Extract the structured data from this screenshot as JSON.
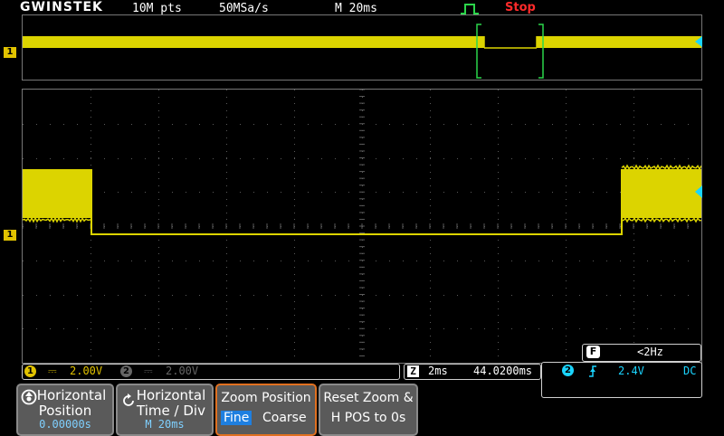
{
  "header": {
    "brand": "GWINSTEK",
    "record_length": "10M pts",
    "sample_rate": "50MSa/s",
    "timebase": "M 20ms",
    "acquire_status": "Stop",
    "status_color": "#ff2a2a",
    "trigger_type_icon": "edge-trigger-icon"
  },
  "colors": {
    "ch1": "#dcd400",
    "grid_dot": "#5a5a5a",
    "zoom_bracket": "#2bd64a",
    "trigger_marker": "#2bd64a",
    "position_marker": "#ff5a2a",
    "level_marker": "#1ad4ff"
  },
  "overview": {
    "channel_label": "1"
  },
  "main": {
    "channel_label": "1"
  },
  "freq_counter": {
    "label": "F",
    "value": "<2Hz"
  },
  "channel_bar": {
    "ch1_num": "1",
    "ch1_coupling": "⎓",
    "ch1_scale": "2.00V",
    "ch2_num": "2",
    "ch2_coupling": "⎓",
    "ch2_scale": "2.00V"
  },
  "zoom_bar": {
    "icon": "Z",
    "time_div": "2ms",
    "position": "44.0200ms"
  },
  "trigger_box": {
    "source": "2",
    "slope": "rising-edge-icon",
    "level": "2.4V",
    "coupling": "DC"
  },
  "softkeys": {
    "h_position": {
      "label1": "Horizontal",
      "label2": "Position",
      "value": "0.00000s"
    },
    "h_timediv": {
      "label1": "Horizontal",
      "label2": "Time / Div",
      "value": "M 20ms"
    },
    "zoom_position": {
      "label1": "Zoom Position",
      "opt_fine": "Fine",
      "opt_coarse": "Coarse"
    },
    "reset_zoom": {
      "label1": "Reset Zoom &",
      "label2": "H POS to 0s"
    }
  }
}
